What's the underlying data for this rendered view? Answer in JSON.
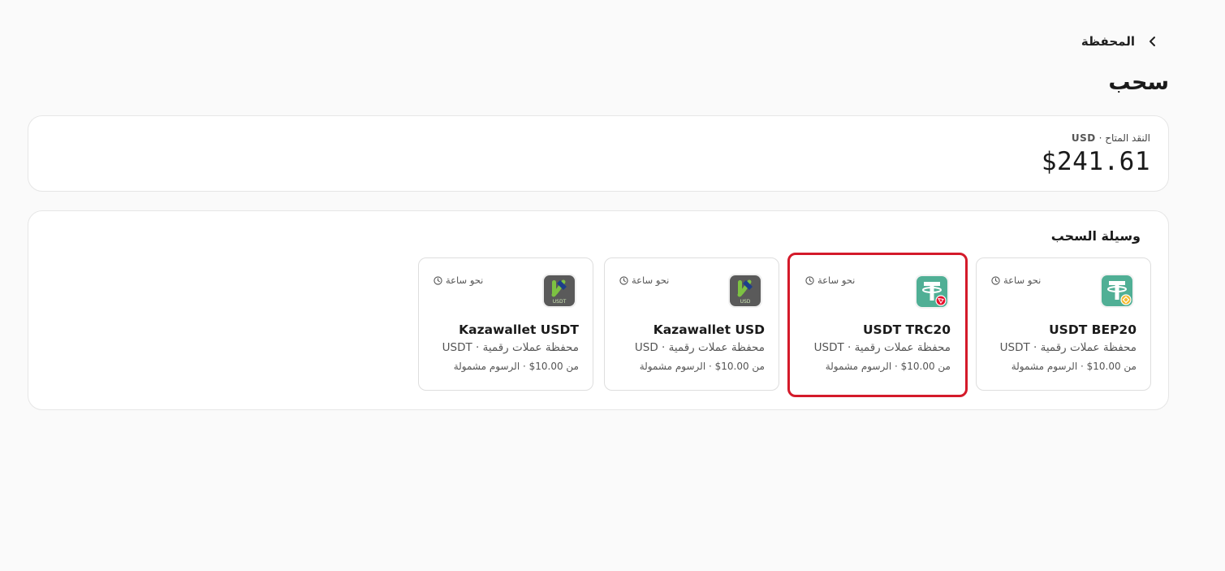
{
  "header": {
    "back_label": "المحفظة",
    "title": "سحب"
  },
  "balance": {
    "label": "النقد المتاح",
    "currency": "USD",
    "amount": "$241.61"
  },
  "methods": {
    "title": "وسيلة السحب",
    "selected_index": 1,
    "items": [
      {
        "name": "USDT BEP20",
        "subtitle": "محفظة عملات رقمية · USDT",
        "fee": "من 10.00$ · الرسوم مشمولة",
        "time": "نحو ساعة",
        "icon": "usdt-bep20-icon"
      },
      {
        "name": "USDT TRC20",
        "subtitle": "محفظة عملات رقمية · USDT",
        "fee": "من 10.00$ · الرسوم مشمولة",
        "time": "نحو ساعة",
        "icon": "usdt-trc20-icon"
      },
      {
        "name": "Kazawallet USD",
        "subtitle": "محفظة عملات رقمية · USD",
        "fee": "من 10.00$ · الرسوم مشمولة",
        "time": "نحو ساعة",
        "icon": "kazawallet-usd-icon",
        "badge": "USD"
      },
      {
        "name": "Kazawallet USDT",
        "subtitle": "محفظة عملات رقمية · USDT",
        "fee": "من 10.00$ · الرسوم مشمولة",
        "time": "نحو ساعة",
        "icon": "kazawallet-usdt-icon",
        "badge": "USDT"
      }
    ]
  },
  "colors": {
    "selected_border": "#d41a2a",
    "tether_green": "#50af95",
    "kaza_bg": "#5a5a5a",
    "kaza_green": "#7dc242"
  }
}
